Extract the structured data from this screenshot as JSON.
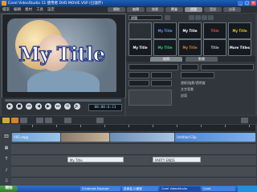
{
  "window": {
    "title": "Corel VideoStudio 11 使用者 DVD MOVIE.VSP (已儲存)",
    "controls": {
      "minimize": "_",
      "maximize": "□",
      "close": "×"
    }
  },
  "menu": [
    "檔案",
    "編輯",
    "素材",
    "工具",
    "設定"
  ],
  "steps": [
    {
      "label": "擷取",
      "active": false
    },
    {
      "label": "編輯",
      "active": false
    },
    {
      "label": "效果",
      "active": false
    },
    {
      "label": "覆疊",
      "active": false
    },
    {
      "label": "標題",
      "active": true
    },
    {
      "label": "音訊",
      "active": false
    },
    {
      "label": "分享",
      "active": false
    }
  ],
  "preview": {
    "overlay_title": "My Title"
  },
  "playback": {
    "buttons": [
      "▶",
      "■",
      "⏮",
      "◀",
      "▶",
      "⏭",
      "⟲",
      "🔊"
    ],
    "timecode": "00:00:6:21"
  },
  "library": {
    "category": "標題",
    "thumbnails": [
      {
        "text": "",
        "color": "#e0e6ec"
      },
      {
        "text": "My Title",
        "color": "#5b8ee6"
      },
      {
        "text": "My Title",
        "color": "#ffffff"
      },
      {
        "text": "Title",
        "color": "#e74c3c"
      },
      {
        "text": "My Title",
        "color": "#f1c40f"
      },
      {
        "text": "My Title",
        "color": "#ffffff"
      },
      {
        "text": "My Title",
        "color": "#2ecc71"
      },
      {
        "text": "My Title",
        "color": "#e67e22"
      },
      {
        "text": "Title",
        "color": "#c0c0c0"
      },
      {
        "text": "More Titles",
        "color": "#ffffff"
      }
    ]
  },
  "options": {
    "tabs": [
      "編輯",
      "動畫"
    ],
    "labels": [
      "邊框/陰影/透明度",
      "文字背景",
      "對齊"
    ]
  },
  "timeline": {
    "tracks": [
      {
        "icon": "🎞",
        "clips": [
          {
            "label": "V01.mpg"
          },
          {
            "label": ""
          },
          {
            "label": ""
          },
          {
            "label": "Untitled Clip"
          }
        ]
      },
      {
        "icon": "▦",
        "clips": []
      },
      {
        "icon": "T",
        "clips": [
          {
            "label": "My Title"
          },
          {
            "label": "PARTY ENDS"
          }
        ]
      },
      {
        "icon": "♪",
        "clips": []
      },
      {
        "icon": "♫",
        "clips": []
      }
    ]
  },
  "taskbar": {
    "start": "開始",
    "tasks": [
      {
        "label": "3 Internet Explorer",
        "active": false
      },
      {
        "label": "未命名-小畫家",
        "active": false
      },
      {
        "label": "Corel VideoStudio",
        "active": true
      },
      {
        "label": "Corel",
        "active": false
      }
    ]
  }
}
